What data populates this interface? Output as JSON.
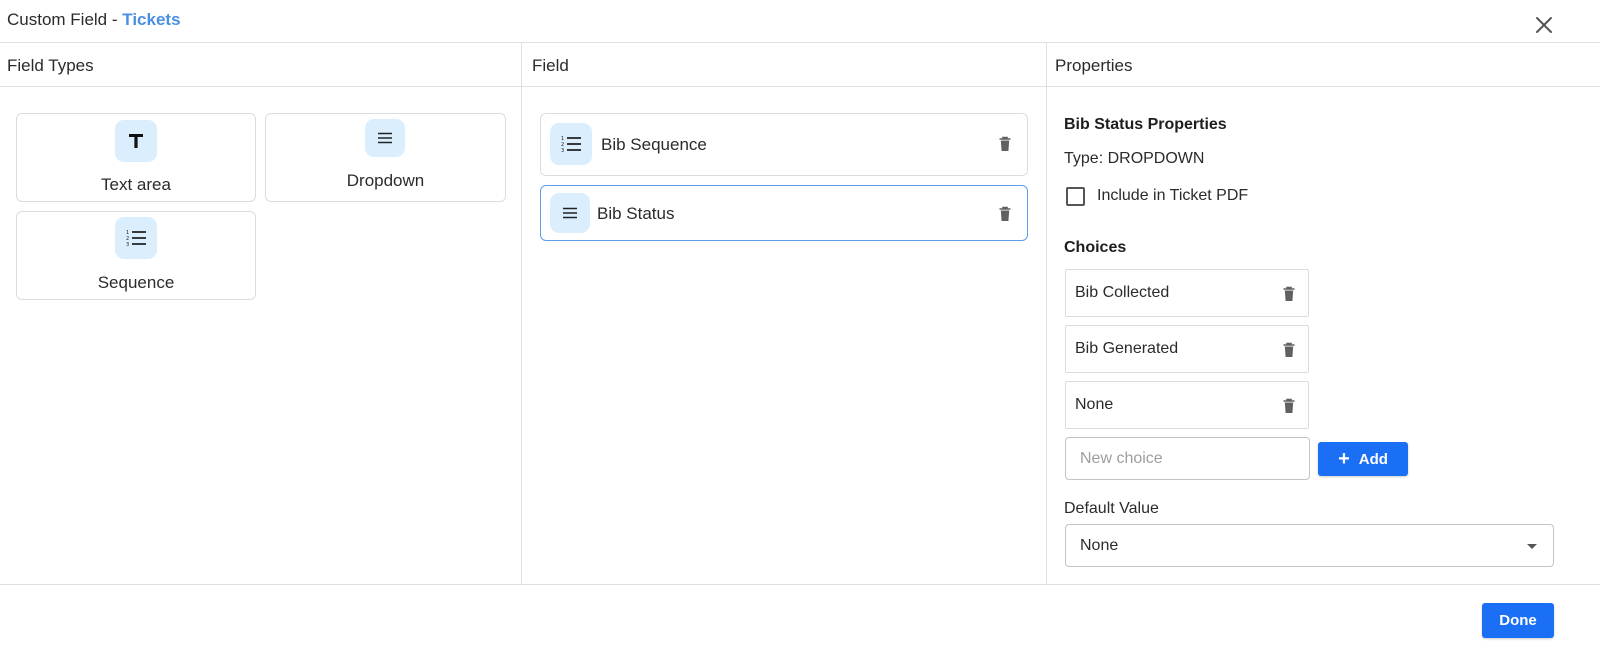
{
  "dialog": {
    "title_prefix": "Custom Field - ",
    "title_entity": "Tickets",
    "accent_color": "#4a90e2",
    "close_icon": "close-icon"
  },
  "columns": {
    "field_types": "Field Types",
    "field": "Field",
    "properties": "Properties"
  },
  "field_types": [
    {
      "label": "Text area",
      "icon": "text-icon"
    },
    {
      "label": "Dropdown",
      "icon": "list-icon"
    },
    {
      "label": "Sequence",
      "icon": "numbered-list-icon"
    }
  ],
  "fields": [
    {
      "label": "Bib Sequence",
      "icon": "numbered-list-icon",
      "selected": false
    },
    {
      "label": "Bib Status",
      "icon": "list-icon",
      "selected": true
    }
  ],
  "properties": {
    "title": "Bib Status Properties",
    "type_text": "Type: DROPDOWN",
    "include_pdf_label": "Include in Ticket PDF",
    "include_pdf_checked": false,
    "choices_title": "Choices",
    "choices": [
      "Bib Collected",
      "Bib Generated",
      "None"
    ],
    "new_choice_placeholder": "New choice",
    "add_label": "Add",
    "default_value_label": "Default Value",
    "default_value": "None"
  },
  "footer": {
    "done_label": "Done",
    "button_color": "#1a6ff5"
  }
}
